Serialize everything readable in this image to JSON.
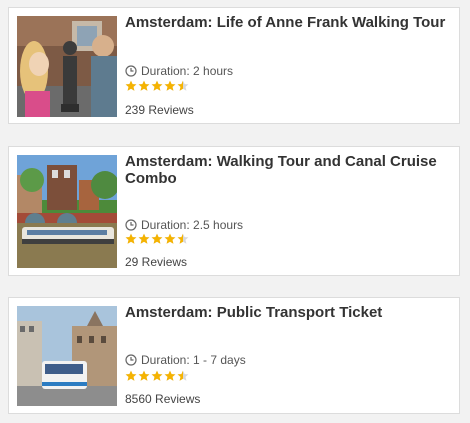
{
  "accent_star_color": "#f5b301",
  "tours": [
    {
      "title": "Amsterdam: Life of Anne Frank Walking Tour",
      "duration": "Duration: 2 hours",
      "rating": 4.5,
      "reviews": "239 Reviews"
    },
    {
      "title": "Amsterdam: Walking Tour and Canal Cruise Combo",
      "duration": "Duration: 2.5 hours",
      "rating": 4.5,
      "reviews": "29 Reviews"
    },
    {
      "title": "Amsterdam: Public Transport Ticket",
      "duration": "Duration: 1 - 7 days",
      "rating": 4.5,
      "reviews": "8560 Reviews"
    }
  ]
}
